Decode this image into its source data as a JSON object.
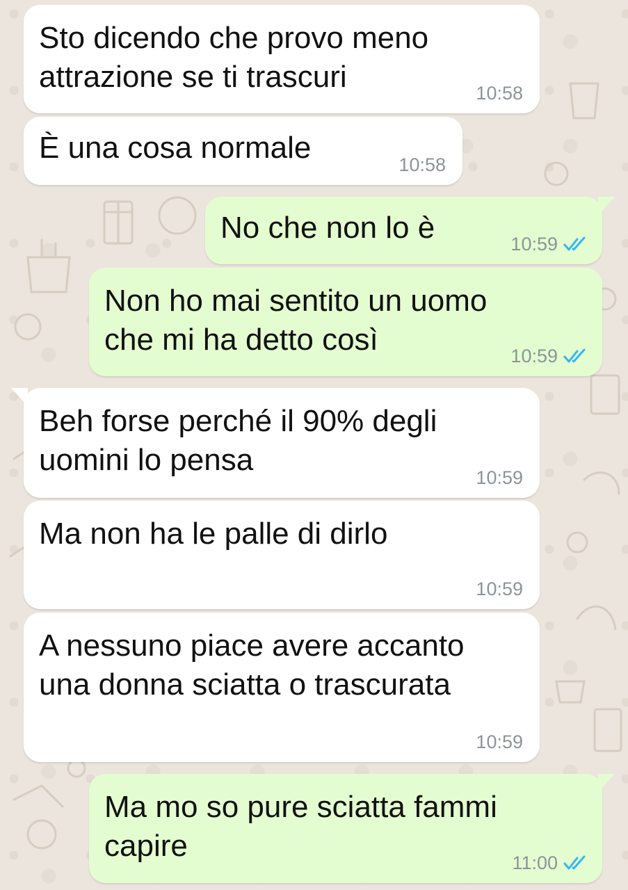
{
  "chat": {
    "messages": [
      {
        "direction": "in",
        "lines": [
          "Sto dicendo che provo meno",
          "attrazione se ti trascuri"
        ],
        "time": "10:58"
      },
      {
        "direction": "in",
        "lines": [
          "È una cosa normale"
        ],
        "time": "10:58"
      },
      {
        "direction": "out",
        "lines": [
          "No che non lo è"
        ],
        "time": "10:59",
        "status": "read-double-check-icon"
      },
      {
        "direction": "out",
        "lines": [
          "Non ho mai sentito un uomo",
          "che mi ha detto così"
        ],
        "time": "10:59",
        "status": "read-double-check-icon"
      },
      {
        "direction": "in",
        "lines": [
          "Beh forse perché il 90% degli",
          "uomini lo pensa"
        ],
        "time": "10:59"
      },
      {
        "direction": "in",
        "lines": [
          "Ma non ha le palle di dirlo"
        ],
        "time": "10:59"
      },
      {
        "direction": "in",
        "lines": [
          "A nessuno piace avere accanto",
          "una donna sciatta o trascurata"
        ],
        "time": "10:59"
      },
      {
        "direction": "out",
        "lines": [
          "Ma mo so pure sciatta fammi",
          "capire"
        ],
        "time": "11:00",
        "status": "read-double-check-icon"
      }
    ]
  },
  "colors": {
    "wallpaper": "#ece5dd",
    "incoming_bubble": "#ffffff",
    "outgoing_bubble": "#e4fdd0",
    "timestamp": "#8c9499",
    "read_ticks": "#34b7f1"
  }
}
